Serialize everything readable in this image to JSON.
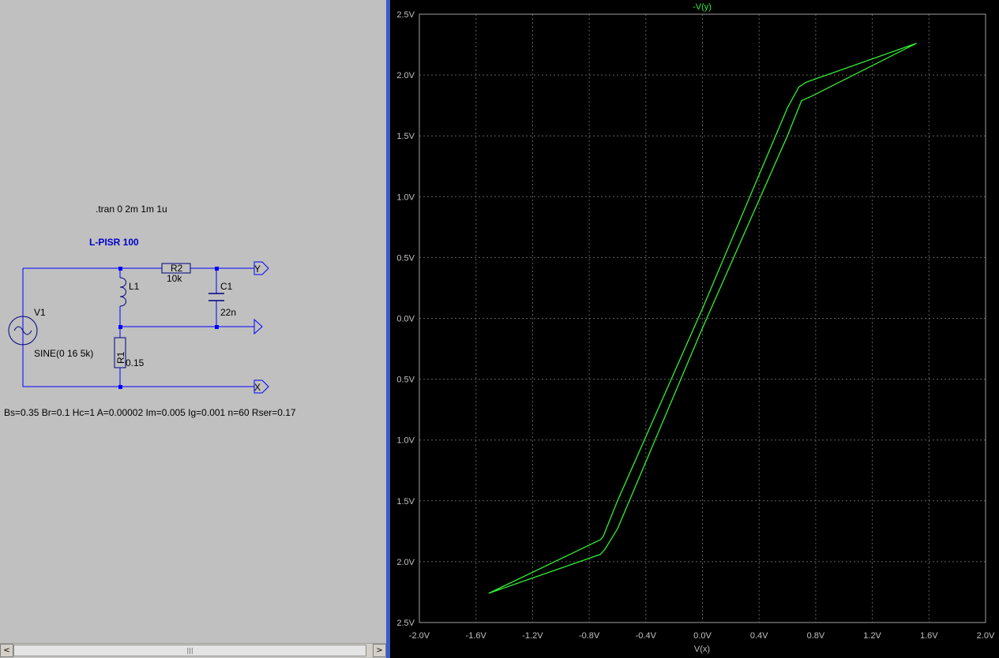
{
  "schematic": {
    "directive": ".tran 0 2m 1m 1u",
    "inductor_model": "L-PISR 100",
    "source_name": "V1",
    "source_value": "SINE(0 16 5k)",
    "l1_name": "L1",
    "r1_name": "R1",
    "r1_value": "0.15",
    "r2_name": "R2",
    "r2_value": "10k",
    "c1_name": "C1",
    "c1_value": "22n",
    "node_y": "Y",
    "node_x": "X",
    "params": "Bs=0.35 Br=0.1 Hc=1 A=0.00002 Im=0.005 Ig=0.001 n=60 Rser=0.17",
    "scrollbar_left": "<",
    "scrollbar_right": ">",
    "scrollbar_grip": "|||"
  },
  "colors": {
    "wire": "#0000ff",
    "component": "#000080",
    "trace": "#33ee33",
    "grid": "#606060",
    "axis_text": "#c0c0c0"
  },
  "chart_data": {
    "type": "line",
    "title": "-V(y)",
    "xlabel": "V(x)",
    "ylabel": "",
    "xlim": [
      -2.0,
      2.0
    ],
    "ylim": [
      -2.5,
      2.5
    ],
    "grid": true,
    "x_ticks": [
      "-2.0V",
      "-1.6V",
      "-1.2V",
      "-0.8V",
      "-0.4V",
      "0.0V",
      "0.4V",
      "0.8V",
      "1.2V",
      "1.6V",
      "2.0V"
    ],
    "y_ticks": [
      "2.5V",
      "2.0V",
      "1.5V",
      "1.0V",
      "0.5V",
      "0.0V",
      "0.5V",
      "1.0V",
      "1.5V",
      "2.0V",
      "2.5V"
    ],
    "series": [
      {
        "name": "-V(y)",
        "x": [
          -1.51,
          -0.72,
          -0.7,
          -0.6,
          0.0,
          0.6,
          0.68,
          0.73,
          1.51,
          0.76,
          0.7,
          0.6,
          0.0,
          -0.6,
          -0.69,
          -0.72,
          -1.51
        ],
        "y": [
          -2.26,
          -1.82,
          -1.79,
          -1.5,
          0.08,
          1.73,
          1.9,
          1.94,
          2.26,
          1.82,
          1.79,
          1.5,
          -0.08,
          -1.73,
          -1.9,
          -1.94,
          -2.26
        ]
      }
    ]
  }
}
